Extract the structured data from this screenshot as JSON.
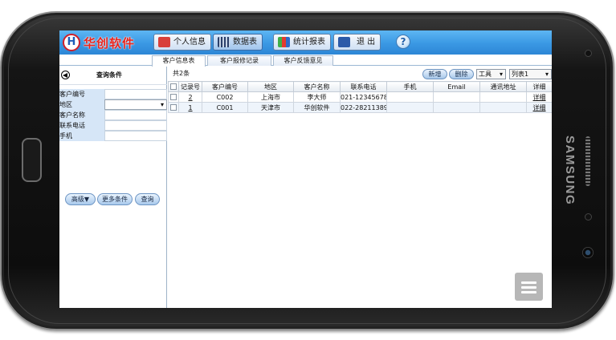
{
  "device": {
    "brand": "SAMSUNG"
  },
  "app": {
    "logo_glyph": "H",
    "name": "华创软件"
  },
  "nav": [
    {
      "label": "个人信息",
      "icon": "person-icon"
    },
    {
      "label": "数据表",
      "icon": "table-icon"
    },
    {
      "label": "统计报表",
      "icon": "chart-icon"
    },
    {
      "label": "退 出",
      "icon": "exit-icon"
    }
  ],
  "help_glyph": "?",
  "tabs": [
    "客户信息表",
    "客户报修记录",
    "客户反馈意见"
  ],
  "filter": {
    "title": "查询条件",
    "fields": [
      {
        "label": "客户编号",
        "value": ""
      },
      {
        "label": "地区",
        "value": ""
      },
      {
        "label": "客户名称",
        "value": ""
      },
      {
        "label": "联系电话",
        "value": ""
      },
      {
        "label": "手机",
        "value": ""
      }
    ],
    "buttons": [
      "高级▼",
      "更多条件",
      "查询"
    ]
  },
  "grid": {
    "count_text": "共2条",
    "actions": {
      "add": "新增",
      "delete": "删除",
      "tools": "工具",
      "view": "列表1"
    },
    "columns": [
      "",
      "记录号",
      "客户编号",
      "地区",
      "客户名称",
      "联系电话",
      "手机",
      "Email",
      "通讯地址",
      "详细"
    ],
    "rows": [
      {
        "record": "2",
        "code": "C002",
        "region": "上海市",
        "name": "李大师",
        "phone": "021-12345678",
        "mobile": "",
        "email": "",
        "address": "",
        "detail": "详细"
      },
      {
        "record": "1",
        "code": "C001",
        "region": "天津市",
        "name": "华创软件",
        "phone": "022-28211389",
        "mobile": "",
        "email": "",
        "address": "",
        "detail": "详细"
      }
    ]
  },
  "colors": {
    "topbar": "#3a98e3",
    "accent": "#e8231c",
    "label_bg": "#d6e6f7"
  }
}
